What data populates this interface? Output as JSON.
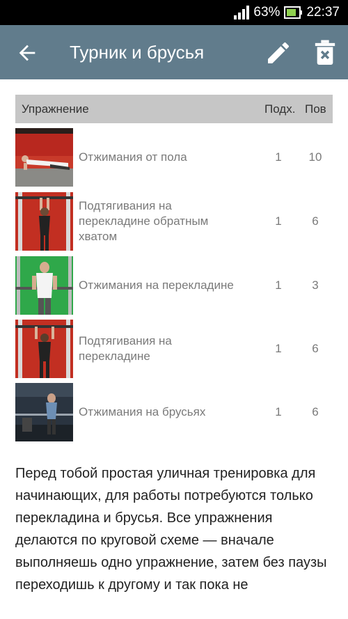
{
  "status_bar": {
    "battery": "63%",
    "time": "22:37"
  },
  "app_bar": {
    "title": "Турник и брусья",
    "back_icon": "arrow-back-icon",
    "edit_icon": "pencil-icon",
    "delete_icon": "trash-x-icon"
  },
  "table": {
    "headers": {
      "exercise": "Упражнение",
      "sets": "Подх.",
      "reps": "Пов"
    },
    "rows": [
      {
        "name": "Отжимания от пола",
        "sets": "1",
        "reps": "10",
        "thumb": "pushup-floor-photo"
      },
      {
        "name": "Подтягивания на перекладине обратным хватом",
        "sets": "1",
        "reps": "6",
        "thumb": "chinup-reverse-grip-photo"
      },
      {
        "name": "Отжимания на перекладине",
        "sets": "1",
        "reps": "3",
        "thumb": "bar-dip-photo"
      },
      {
        "name": "Подтягивания на перекладине",
        "sets": "1",
        "reps": "6",
        "thumb": "pullup-photo"
      },
      {
        "name": "Отжимания на брусьях",
        "sets": "1",
        "reps": "6",
        "thumb": "parallel-bar-dip-photo"
      }
    ]
  },
  "description": "Перед тобой простая уличная тренировка для начинающих, для работы потребуются только перекладина и брусья. Все упражнения делаются по круговой схеме — вначале выполняешь одно упражнение, затем без паузы переходишь к другому и так пока не",
  "colors": {
    "app_bar": "#617c8c",
    "status_bar": "#000000",
    "table_header": "#c6c6c6",
    "battery": "#8fd14f"
  }
}
